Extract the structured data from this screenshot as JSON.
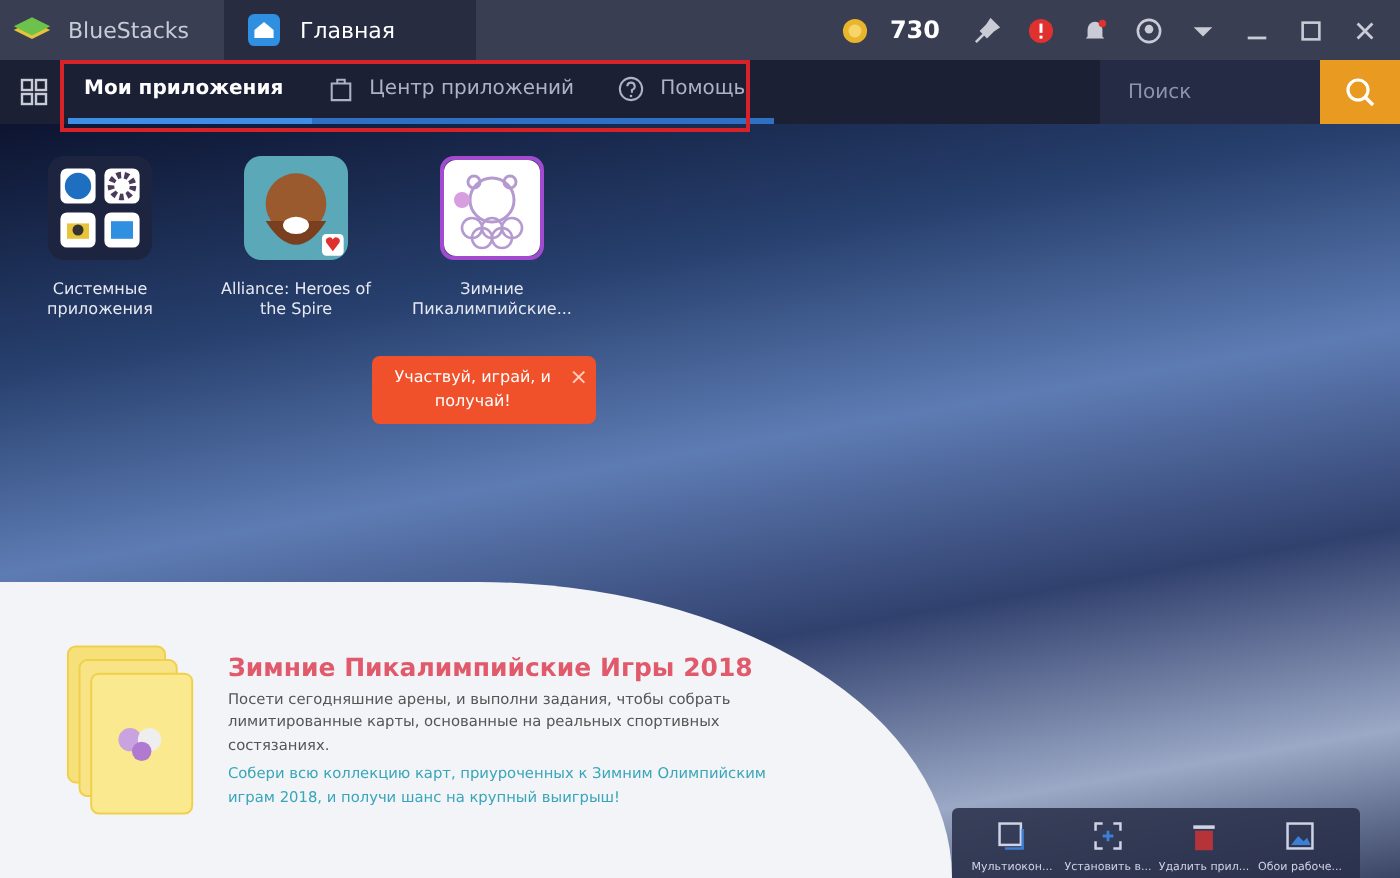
{
  "title_bar": {
    "app_name": "BlueStacks",
    "tab": {
      "label": "Главная",
      "selected": true
    },
    "coins": "730"
  },
  "nav": {
    "tabs": [
      {
        "label": "Мои приложения",
        "selected": true
      },
      {
        "label": "Центр приложений",
        "selected": false
      },
      {
        "label": "Помощь",
        "selected": false
      }
    ],
    "search": {
      "placeholder": "Поиск"
    }
  },
  "apps": [
    {
      "label": "Системные приложения"
    },
    {
      "label": "Alliance: Heroes of the Spire"
    },
    {
      "label": "Зимние Пикалимпийские..."
    }
  ],
  "tooltip": {
    "text": "Участвуй, играй, и получай!",
    "close": "×"
  },
  "promo": {
    "title": "Зимние Пикалимпийские Игры 2018",
    "description": "Посети сегодняшние арены, и выполни задания, чтобы собрать лимитированные карты, основанные на реальных спортивных состязаниях.",
    "highlight": "Собери всю коллекцию карт, приуроченных к Зимним Олимпийским играм 2018, и получи шанс на крупный выигрыш!"
  },
  "toolbar": [
    {
      "label": "Мультиокон..."
    },
    {
      "label": "Установить в..."
    },
    {
      "label": "Удалить прил..."
    },
    {
      "label": "Обои рабоче..."
    }
  ]
}
